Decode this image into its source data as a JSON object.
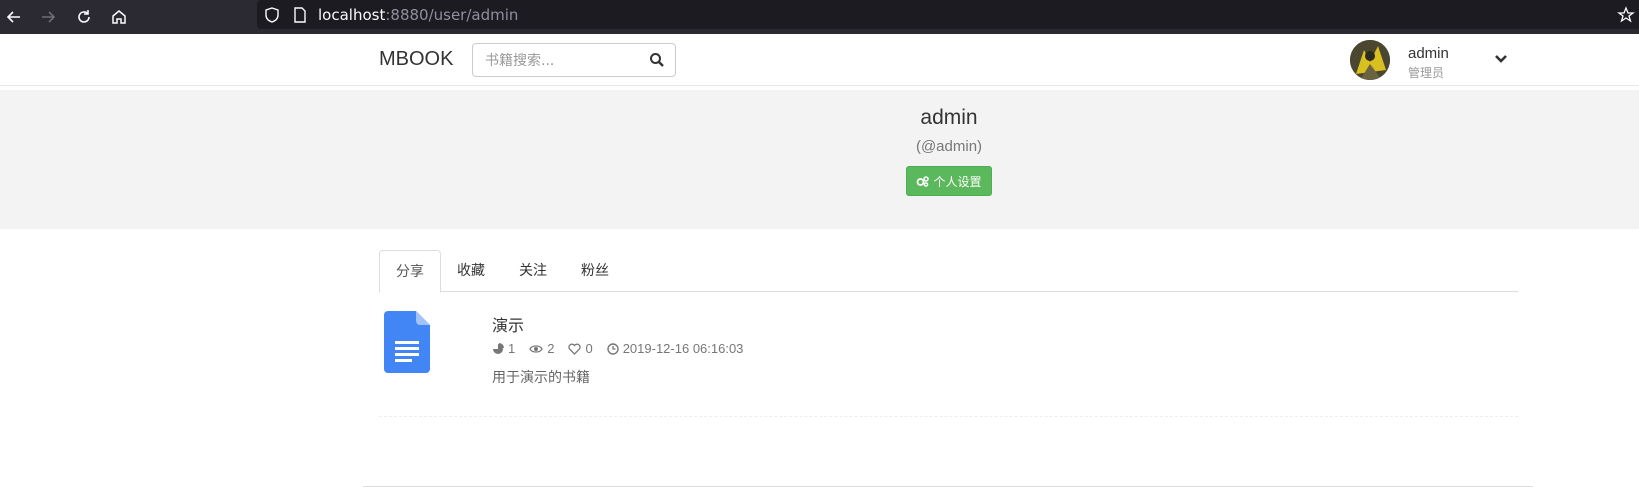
{
  "browser": {
    "url_host": "localhost",
    "url_rest": ":8880/user/admin"
  },
  "header": {
    "brand": "MBOOK",
    "search_placeholder": "书籍搜索...",
    "user_name": "admin",
    "user_role": "管理员"
  },
  "profile": {
    "name": "admin",
    "handle": "(@admin)",
    "settings_label": "个人设置"
  },
  "tabs": [
    {
      "label": "分享",
      "active": true
    },
    {
      "label": "收藏",
      "active": false
    },
    {
      "label": "关注",
      "active": false
    },
    {
      "label": "粉丝",
      "active": false
    }
  ],
  "books": [
    {
      "title": "演示",
      "shares": "1",
      "views": "2",
      "likes": "0",
      "date": "2019-12-16 06:16:03",
      "description": "用于演示的书籍"
    }
  ],
  "colors": {
    "primary_green": "#5cb85c",
    "doc_blue": "#4285f4",
    "chrome_bg": "#2b2a33"
  }
}
